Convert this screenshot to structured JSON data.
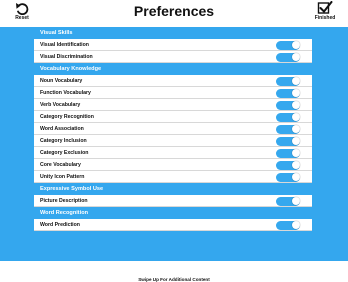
{
  "header": {
    "title": "Preferences",
    "reset_label": "Reset",
    "finished_label": "Finished"
  },
  "sections": [
    {
      "title": "Visual Skills",
      "items": [
        {
          "label": "Visual Identification",
          "on": true
        },
        {
          "label": "Visual Discrimination",
          "on": true
        }
      ]
    },
    {
      "title": "Vocabulary Knowledge",
      "items": [
        {
          "label": "Noun Vocabulary",
          "on": true
        },
        {
          "label": "Function Vocabulary",
          "on": true
        },
        {
          "label": "Verb Vocabulary",
          "on": true
        },
        {
          "label": "Category Recognition",
          "on": true
        },
        {
          "label": "Word Association",
          "on": true
        },
        {
          "label": "Category Inclusion",
          "on": true
        },
        {
          "label": "Category Exclusion",
          "on": true
        },
        {
          "label": "Core Vocabulary",
          "on": true
        },
        {
          "label": "Unity Icon Pattern",
          "on": true
        }
      ]
    },
    {
      "title": "Expressive Symbol Use",
      "items": [
        {
          "label": "Picture Description",
          "on": true
        }
      ]
    },
    {
      "title": "Word Recognition",
      "items": [
        {
          "label": "Word Prediction",
          "on": true
        }
      ]
    }
  ],
  "footer": {
    "text": "Swipe Up For Additional Content"
  },
  "colors": {
    "accent": "#34a7ee",
    "toggle_on": "#35a8ee"
  },
  "icons": {
    "reset": "undo-arrow-icon",
    "finished": "checkbox-checked-icon"
  }
}
